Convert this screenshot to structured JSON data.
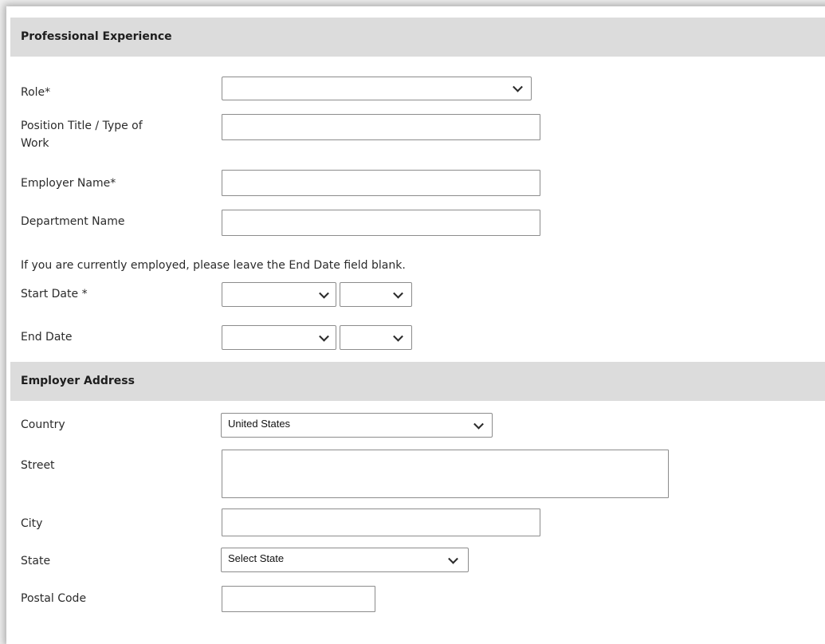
{
  "professional_experience": {
    "header": "Professional Experience",
    "role_label": "Role*",
    "role_value": "",
    "position_title_label_line1": "Position Title / Type of",
    "position_title_label_line2": "Work",
    "employer_name_label": "Employer Name*",
    "department_name_label": "Department Name",
    "employment_note": "If you are currently employed, please leave the End Date field blank.",
    "start_date_label": "Start Date *",
    "end_date_label": "End Date"
  },
  "employer_address": {
    "header": "Employer Address",
    "country_label": "Country",
    "country_value": "United States",
    "street_label": "Street",
    "city_label": "City",
    "state_label": "State",
    "state_value": "Select State",
    "postal_code_label": "Postal Code"
  },
  "icons": {
    "dropdown": "chevron-down-icon"
  },
  "colors": {
    "section_header_bg": "#dcdcdc",
    "field_border": "#8c8c8c"
  }
}
